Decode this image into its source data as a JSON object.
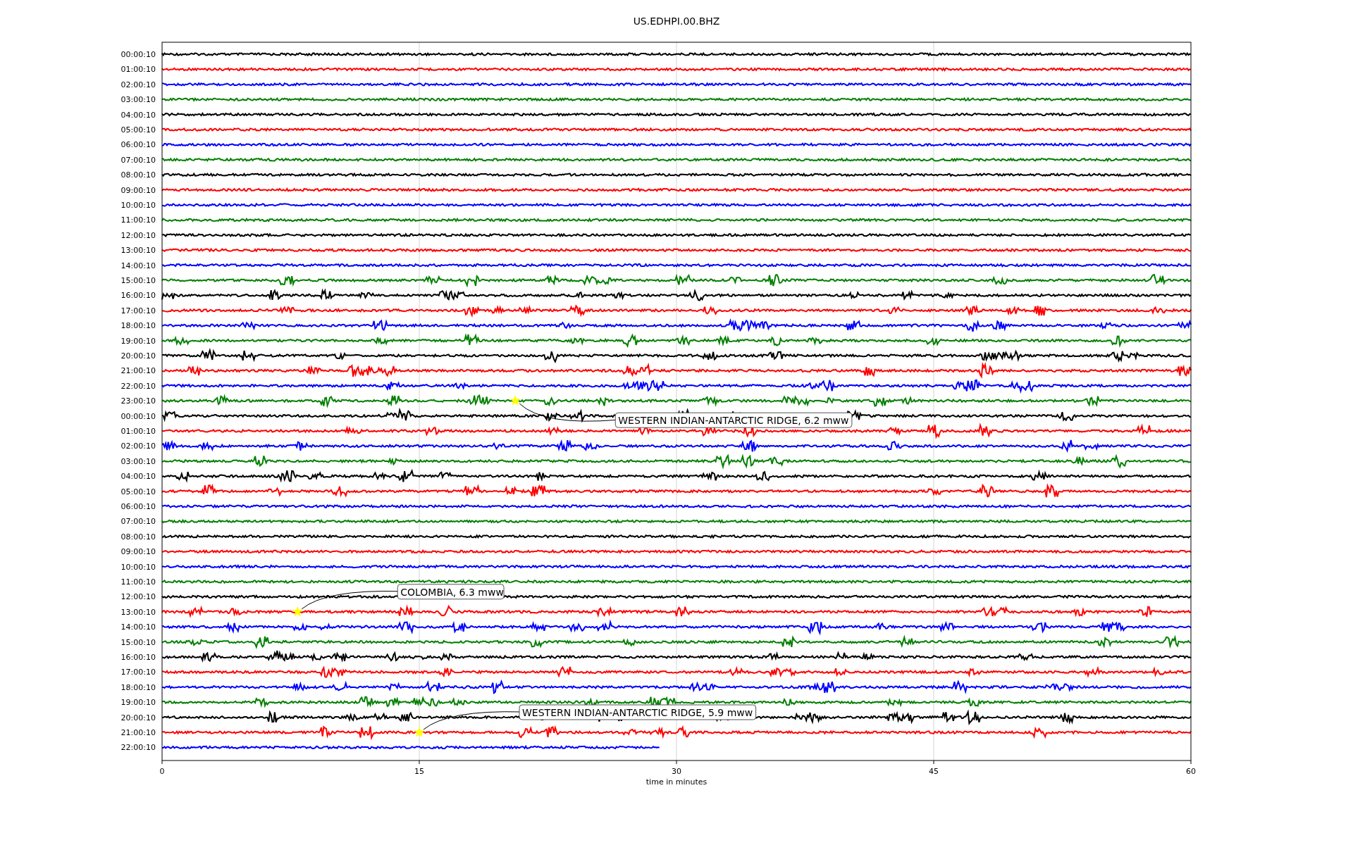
{
  "title": "US.EDHPI.00.BHZ",
  "xlabel": "time in minutes",
  "xticks": [
    "0",
    "15",
    "30",
    "45",
    "60"
  ],
  "rows": [
    {
      "label": "00:00:10",
      "color": "#000000",
      "complete": true
    },
    {
      "label": "01:00:10",
      "color": "#ff0000",
      "complete": true
    },
    {
      "label": "02:00:10",
      "color": "#0000ff",
      "complete": true
    },
    {
      "label": "03:00:10",
      "color": "#008000",
      "complete": true
    },
    {
      "label": "04:00:10",
      "color": "#000000",
      "complete": true
    },
    {
      "label": "05:00:10",
      "color": "#ff0000",
      "complete": true
    },
    {
      "label": "06:00:10",
      "color": "#0000ff",
      "complete": true
    },
    {
      "label": "07:00:10",
      "color": "#008000",
      "complete": true
    },
    {
      "label": "08:00:10",
      "color": "#000000",
      "complete": true
    },
    {
      "label": "09:00:10",
      "color": "#ff0000",
      "complete": true
    },
    {
      "label": "10:00:10",
      "color": "#0000ff",
      "complete": true
    },
    {
      "label": "11:00:10",
      "color": "#008000",
      "complete": true
    },
    {
      "label": "12:00:10",
      "color": "#000000",
      "complete": true
    },
    {
      "label": "13:00:10",
      "color": "#ff0000",
      "complete": true
    },
    {
      "label": "14:00:10",
      "color": "#0000ff",
      "complete": true
    },
    {
      "label": "15:00:10",
      "color": "#008000",
      "complete": true
    },
    {
      "label": "16:00:10",
      "color": "#000000",
      "complete": true
    },
    {
      "label": "17:00:10",
      "color": "#ff0000",
      "complete": true
    },
    {
      "label": "18:00:10",
      "color": "#0000ff",
      "complete": true
    },
    {
      "label": "19:00:10",
      "color": "#008000",
      "complete": true
    },
    {
      "label": "20:00:10",
      "color": "#000000",
      "complete": true
    },
    {
      "label": "21:00:10",
      "color": "#ff0000",
      "complete": true
    },
    {
      "label": "22:00:10",
      "color": "#0000ff",
      "complete": true
    },
    {
      "label": "23:00:10",
      "color": "#008000",
      "complete": true,
      "event": "WESTERN INDIAN-ANTARCTIC RIDGE, 6.2 mww"
    },
    {
      "label": "00:00:10",
      "color": "#000000",
      "complete": true
    },
    {
      "label": "01:00:10",
      "color": "#ff0000",
      "complete": true
    },
    {
      "label": "02:00:10",
      "color": "#0000ff",
      "complete": true
    },
    {
      "label": "03:00:10",
      "color": "#008000",
      "complete": true
    },
    {
      "label": "04:00:10",
      "color": "#000000",
      "complete": true
    },
    {
      "label": "05:00:10",
      "color": "#ff0000",
      "complete": true
    },
    {
      "label": "06:00:10",
      "color": "#0000ff",
      "complete": true
    },
    {
      "label": "07:00:10",
      "color": "#008000",
      "complete": true
    },
    {
      "label": "08:00:10",
      "color": "#000000",
      "complete": true
    },
    {
      "label": "09:00:10",
      "color": "#ff0000",
      "complete": true
    },
    {
      "label": "10:00:10",
      "color": "#0000ff",
      "complete": true
    },
    {
      "label": "11:00:10",
      "color": "#008000",
      "complete": true
    },
    {
      "label": "12:00:10",
      "color": "#000000",
      "complete": true
    },
    {
      "label": "13:00:10",
      "color": "#ff0000",
      "complete": true,
      "event": "COLOMBIA, 6.3 mww"
    },
    {
      "label": "14:00:10",
      "color": "#0000ff",
      "complete": true
    },
    {
      "label": "15:00:10",
      "color": "#008000",
      "complete": true
    },
    {
      "label": "16:00:10",
      "color": "#000000",
      "complete": true
    },
    {
      "label": "17:00:10",
      "color": "#ff0000",
      "complete": true
    },
    {
      "label": "18:00:10",
      "color": "#0000ff",
      "complete": true
    },
    {
      "label": "19:00:10",
      "color": "#008000",
      "complete": true
    },
    {
      "label": "20:00:10",
      "color": "#000000",
      "complete": true
    },
    {
      "label": "21:00:10",
      "color": "#ff0000",
      "complete": true,
      "event": "WESTERN INDIAN-ANTARCTIC RIDGE, 5.9 mww"
    },
    {
      "label": "22:00:10",
      "color": "#0000ff",
      "complete": false
    }
  ]
}
